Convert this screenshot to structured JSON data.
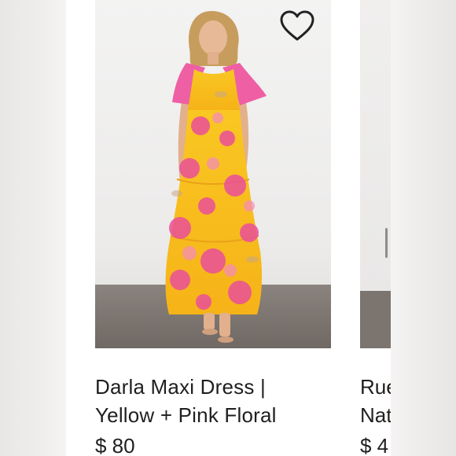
{
  "products": [
    {
      "name_line1": "Darla Maxi Dress |",
      "name_line2": "Yellow + Pink Floral",
      "price": "$ 80",
      "favorite_icon": "heart-outline-icon"
    },
    {
      "name_line1": "Rue",
      "name_line2": "Nat",
      "price": "$ 4"
    }
  ],
  "colors": {
    "dress_yellow": "#f7c51d",
    "dress_pink": "#ea4f9a",
    "text": "#1f1f1f",
    "card_bg": "#ffffff"
  }
}
